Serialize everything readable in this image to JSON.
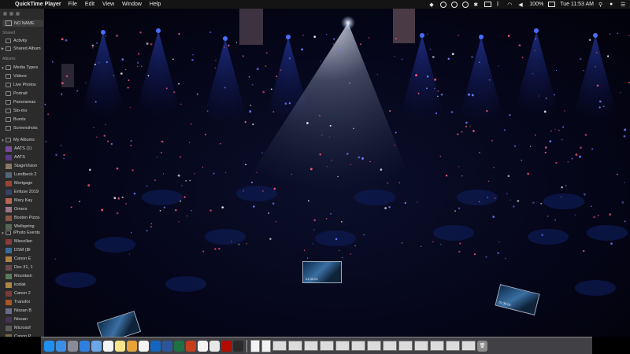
{
  "menubar": {
    "app_name": "QuickTime Player",
    "menus": [
      "File",
      "Edit",
      "View",
      "Window",
      "Help"
    ],
    "battery": "100%",
    "clock": "Tue 11:53 AM"
  },
  "sidebar": {
    "device_label": "NO NAME",
    "shared_header": "Shared",
    "shared_items": [
      "Activity",
      "Shared Album"
    ],
    "albums_header": "Albums",
    "media_types_label": "Media Types",
    "media_types": [
      "Videos",
      "Live Photos",
      "Portrait",
      "Panoramas",
      "Slo-mo",
      "Bursts",
      "Screenshots"
    ],
    "my_albums_label": "My Albums",
    "my_albums": [
      "AATS (1)",
      "AATS",
      "StageVision",
      "Lundbeck 2",
      "Mortgage",
      "Enfuse 2019",
      "Mary Kay",
      "Omers",
      "Boston Pizza",
      "Wellspring"
    ],
    "iphoto_label": "iPhoto Events",
    "iphoto_events": [
      "Miscellan",
      "DSM (Bl",
      "Canon E",
      "Dec 31, 1",
      "Mountain",
      "kodak",
      "Canon 2",
      "Transfor",
      "Nissan B",
      "Nissan",
      "Microsof",
      "Canon P"
    ]
  },
  "desktop_thumbs": [
    {
      "caption": "01:30:00"
    },
    {
      "caption": "01:30:00"
    },
    {
      "caption": ""
    }
  ],
  "dock": {
    "apps": [
      "finder-icon",
      "app-store-icon",
      "launchpad-icon",
      "safari-icon",
      "mail-icon",
      "calendar-icon",
      "notes-icon",
      "photos-icon",
      "chrome-icon",
      "outlook-icon",
      "word-icon",
      "excel-icon",
      "powerpoint-icon",
      "calendar-icon",
      "itunes-icon",
      "acrobat-icon",
      "vectorworks-icon"
    ],
    "colors": [
      "#1e8ff0",
      "#3b8ee6",
      "#8a8a9a",
      "#2f7fe0",
      "#6aa7e8",
      "#f4f4f4",
      "#f6e58d",
      "#e8a23a",
      "#f4f4f4",
      "#1565c0",
      "#2b579a",
      "#1e7145",
      "#c43e1c",
      "#f4f4f4",
      "#e8e8e8",
      "#b30b00",
      "#2a2a2a"
    ]
  }
}
